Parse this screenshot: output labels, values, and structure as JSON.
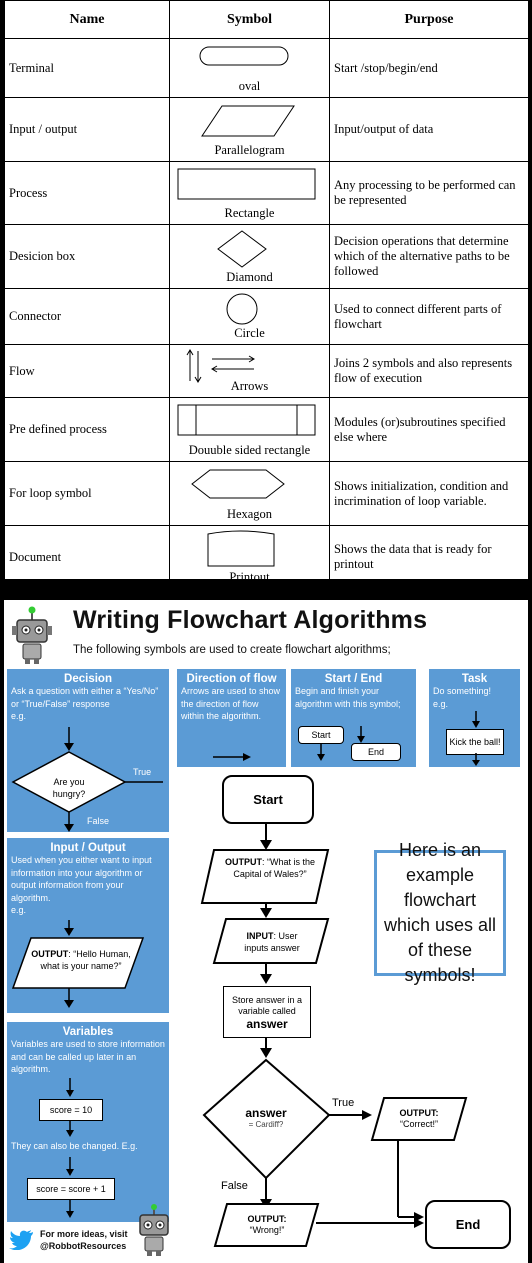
{
  "table": {
    "headers": [
      "Name",
      "Symbol",
      "Purpose"
    ],
    "rows": [
      {
        "name": "Terminal",
        "caption": "oval",
        "purpose": "Start /stop/begin/end",
        "icon": "oval-icon"
      },
      {
        "name": "Input / output",
        "caption": "Parallelogram",
        "purpose": "Input/output of data",
        "icon": "parallelogram-icon"
      },
      {
        "name": "Process",
        "caption": "Rectangle",
        "purpose": "Any processing to be performed can be represented",
        "icon": "rectangle-icon"
      },
      {
        "name": "Desicion box",
        "caption": "Diamond",
        "purpose": "Decision operations that determine which of the alternative paths to be followed",
        "icon": "diamond-icon"
      },
      {
        "name": "Connector",
        "caption": "Circle",
        "purpose": "Used to connect different parts of flowchart",
        "icon": "circle-icon"
      },
      {
        "name": "Flow",
        "caption": "Arrows",
        "purpose": "Joins 2 symbols and also represents flow of execution",
        "icon": "arrows-icon"
      },
      {
        "name": "Pre defined process",
        "caption": "Douuble sided rectangle",
        "purpose": "Modules (or)subroutines specified else where",
        "icon": "double-sided-rectangle-icon"
      },
      {
        "name": "For loop symbol",
        "caption": "Hexagon",
        "purpose": "Shows initialization, condition and incrimination of loop variable.",
        "icon": "hexagon-icon"
      },
      {
        "name": "Document",
        "caption": "Printout",
        "purpose": "Shows the data that is ready for printout",
        "icon": "document-icon"
      }
    ]
  },
  "poster": {
    "title": "Writing Flowchart Algorithms",
    "subtitle": "The following symbols are used to create flowchart algorithms;",
    "decision": {
      "heading": "Decision",
      "text": "Ask a question with either a “Yes/No” or “True/False” response",
      "eg": "e.g.",
      "question": "Are you hungry?",
      "true_label": "True",
      "false_label": "False"
    },
    "direction": {
      "heading": "Direction of flow",
      "text": "Arrows are used to show the direction of flow within the algorithm."
    },
    "startend": {
      "heading": "Start / End",
      "text": "Begin and finish your algorithm with this symbol;",
      "start": "Start",
      "end": "End"
    },
    "task": {
      "heading": "Task",
      "text": "Do something!",
      "eg": "e.g.",
      "example": "Kick the ball!"
    },
    "io": {
      "heading": "Input / Output",
      "text": "Used when you either want to input information into your algorithm or output information from your algorithm.",
      "eg": "e.g.",
      "output_kw": "OUTPUT",
      "output_text": ": “Hello Human, what is your name?”"
    },
    "variables": {
      "heading": "Variables",
      "text": "Variables are used to store information and can be called up later in an algorithm.",
      "box1": "score = 10",
      "changed": "They can also be changed. E.g.",
      "box2": "score = score + 1"
    },
    "footer": {
      "line1": "For more ideas, visit",
      "line2": "@RobbotResources"
    },
    "flow": {
      "start": "Start",
      "out1_kw": "OUTPUT",
      "out1_text": ": “What is the Capital of Wales?”",
      "in_kw": "INPUT",
      "in_text": ": User inputs answer",
      "store_text": "Store answer in a variable called",
      "store_kw": "answer",
      "dec_kw": "answer",
      "dec_text": "= Cardiff?",
      "true_label": "True",
      "false_label": "False",
      "correct_kw": "OUTPUT:",
      "correct_text": "“Correct!”",
      "wrong_kw": "OUTPUT:",
      "wrong_text": "“Wrong!”",
      "end": "End"
    },
    "note": "Here is an example flowchart which uses all of these symbols!"
  }
}
